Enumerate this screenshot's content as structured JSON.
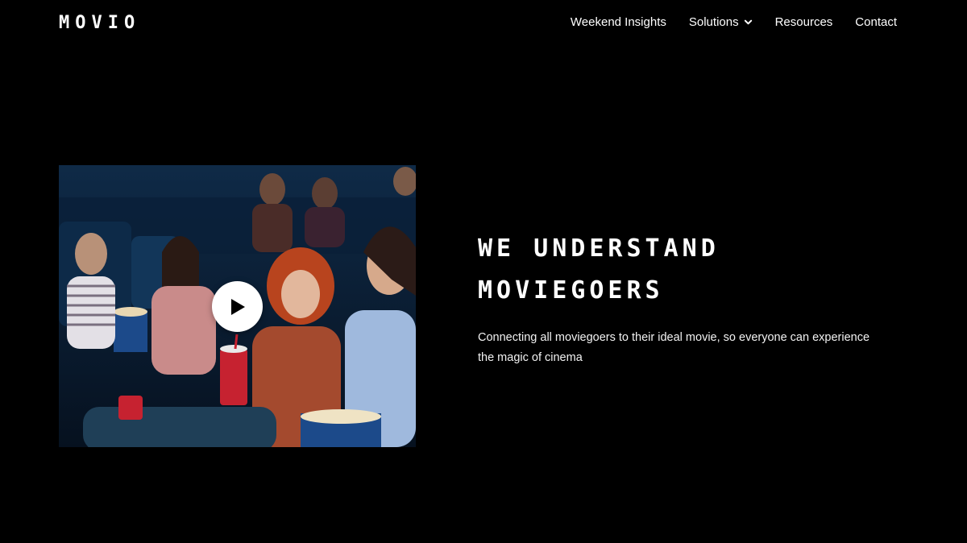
{
  "header": {
    "logo": "MOVIO",
    "nav": [
      {
        "label": "Weekend Insights",
        "has_dropdown": false
      },
      {
        "label": "Solutions",
        "has_dropdown": true
      },
      {
        "label": "Resources",
        "has_dropdown": false
      },
      {
        "label": "Contact",
        "has_dropdown": false
      }
    ]
  },
  "hero": {
    "headline_line1": "WE UNDERSTAND",
    "headline_line2": "MOVIEGOERS",
    "subtext": "Connecting all moviegoers to their ideal movie, so everyone can experience the magic of cinema",
    "media": {
      "icon": "play-icon"
    }
  },
  "colors": {
    "background": "#000000",
    "text": "#ffffff"
  }
}
